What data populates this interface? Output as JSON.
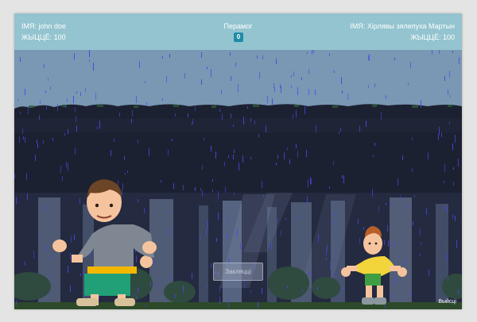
{
  "player1": {
    "name_line": "ІМЯ: john doe",
    "health_line": "ЖЫЦЦЁ: 100"
  },
  "player2": {
    "name_line": "ІМЯ: Хірлявы зялепуха Мартын",
    "health_line": "ЖЫЦЦЁ: 100"
  },
  "score": {
    "label": "Перамог",
    "value": "0"
  },
  "spell_button_label": "Закляцці",
  "exit_label": "Выйсці",
  "colors": {
    "hud": "#93c4cf",
    "sky": "#7a97b4",
    "canopy": "#1f2434",
    "badge": "#1f8ca6",
    "rain": "#4d45e0"
  },
  "scene": {
    "setting": "rainy night forest",
    "weather": "rain"
  }
}
